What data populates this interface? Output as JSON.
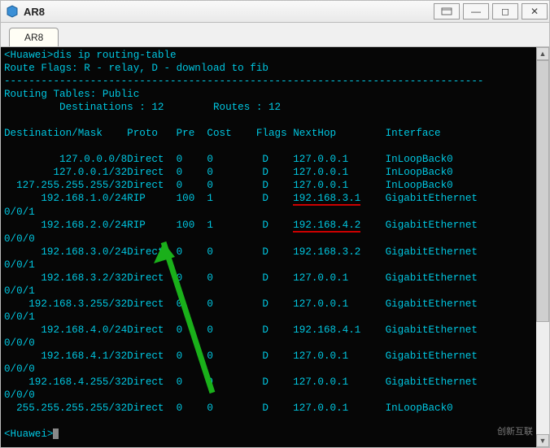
{
  "window": {
    "title": "AR8"
  },
  "tab": {
    "label": "AR8"
  },
  "watermark": "创新互联",
  "cli": {
    "cmd": "<Huawei>dis ip routing-table",
    "flags": "Route Flags: R - relay, D - download to fib",
    "dash": "------------------------------------------------------------------------------",
    "tables": "Routing Tables: Public",
    "summary_label_d": "Destinations :",
    "summary_value_d": "12",
    "summary_label_r": "Routes :",
    "summary_value_r": "12",
    "hdr": {
      "dest": "Destination/Mask",
      "proto": "Proto",
      "pre": "Pre",
      "cost": "Cost",
      "flags": "Flags",
      "nexthop": "NextHop",
      "iface": "Interface"
    },
    "routes": [
      {
        "dest": "127.0.0.0/8",
        "proto": "Direct",
        "pre": "0",
        "cost": "0",
        "flags": "D",
        "nexthop": "127.0.0.1",
        "iface": "InLoopBack0",
        "ifaceSuffix": ""
      },
      {
        "dest": "127.0.0.1/32",
        "proto": "Direct",
        "pre": "0",
        "cost": "0",
        "flags": "D",
        "nexthop": "127.0.0.1",
        "iface": "InLoopBack0",
        "ifaceSuffix": ""
      },
      {
        "dest": "127.255.255.255/32",
        "proto": "Direct",
        "pre": "0",
        "cost": "0",
        "flags": "D",
        "nexthop": "127.0.0.1",
        "iface": "InLoopBack0",
        "ifaceSuffix": ""
      },
      {
        "dest": "192.168.1.0/24",
        "proto": "RIP",
        "pre": "100",
        "cost": "1",
        "flags": "D",
        "nexthop": "192.168.3.1",
        "iface": "GigabitEthernet",
        "ifaceSuffix": "0/0/1",
        "highlight": true
      },
      {
        "dest": "192.168.2.0/24",
        "proto": "RIP",
        "pre": "100",
        "cost": "1",
        "flags": "D",
        "nexthop": "192.168.4.2",
        "iface": "GigabitEthernet",
        "ifaceSuffix": "0/0/0",
        "highlight": true
      },
      {
        "dest": "192.168.3.0/24",
        "proto": "Direct",
        "pre": "0",
        "cost": "0",
        "flags": "D",
        "nexthop": "192.168.3.2",
        "iface": "GigabitEthernet",
        "ifaceSuffix": "0/0/1"
      },
      {
        "dest": "192.168.3.2/32",
        "proto": "Direct",
        "pre": "0",
        "cost": "0",
        "flags": "D",
        "nexthop": "127.0.0.1",
        "iface": "GigabitEthernet",
        "ifaceSuffix": "0/0/1"
      },
      {
        "dest": "192.168.3.255/32",
        "proto": "Direct",
        "pre": "0",
        "cost": "0",
        "flags": "D",
        "nexthop": "127.0.0.1",
        "iface": "GigabitEthernet",
        "ifaceSuffix": "0/0/1"
      },
      {
        "dest": "192.168.4.0/24",
        "proto": "Direct",
        "pre": "0",
        "cost": "0",
        "flags": "D",
        "nexthop": "192.168.4.1",
        "iface": "GigabitEthernet",
        "ifaceSuffix": "0/0/0"
      },
      {
        "dest": "192.168.4.1/32",
        "proto": "Direct",
        "pre": "0",
        "cost": "0",
        "flags": "D",
        "nexthop": "127.0.0.1",
        "iface": "GigabitEthernet",
        "ifaceSuffix": "0/0/0"
      },
      {
        "dest": "192.168.4.255/32",
        "proto": "Direct",
        "pre": "0",
        "cost": "0",
        "flags": "D",
        "nexthop": "127.0.0.1",
        "iface": "GigabitEthernet",
        "ifaceSuffix": "0/0/0"
      },
      {
        "dest": "255.255.255.255/32",
        "proto": "Direct",
        "pre": "0",
        "cost": "0",
        "flags": "D",
        "nexthop": "127.0.0.1",
        "iface": "InLoopBack0",
        "ifaceSuffix": ""
      }
    ],
    "prompt": "<Huawei>"
  },
  "columns": {
    "destW": 20,
    "protoW": 8,
    "preW": 5,
    "costW": 7,
    "flagsW": 6,
    "nexthopW": 15
  }
}
